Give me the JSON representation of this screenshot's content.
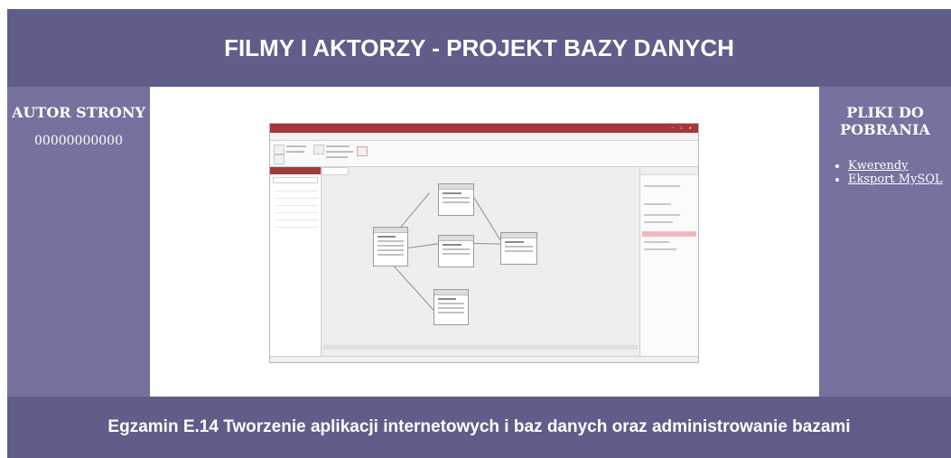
{
  "header": {
    "title": "FILMY I AKTORZY - PROJEKT BAZY DANYCH"
  },
  "left": {
    "title": "AUTOR STRONY",
    "value": "00000000000"
  },
  "right": {
    "title": "PLIKI DO POBRANIA",
    "links": [
      {
        "label": "Kwerendy"
      },
      {
        "label": "Eksport MySQL"
      }
    ]
  },
  "footer": {
    "text": "Egzamin E.14 Tworzenie aplikacji internetowych i baz danych oraz administrowanie bazami"
  },
  "colors": {
    "header_bg": "#5f5d8a",
    "side_bg": "#75729f",
    "text": "#ffffff",
    "access_accent": "#a4373a"
  },
  "image": {
    "name": "relationship-diagram-screenshot"
  }
}
